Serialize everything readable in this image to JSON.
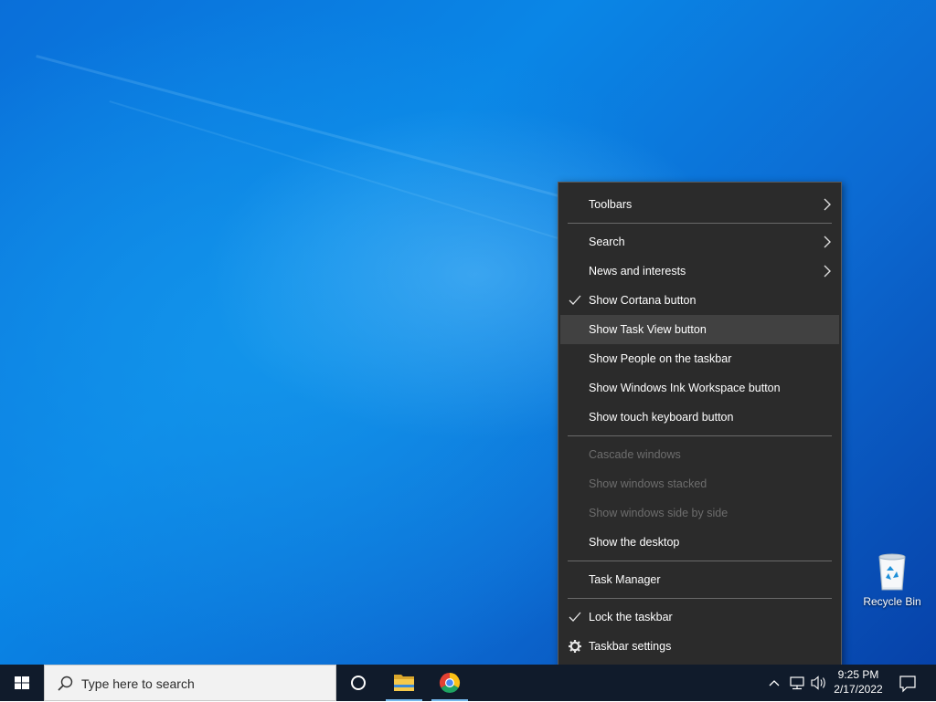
{
  "desktop": {
    "recycle_bin": {
      "label": "Recycle Bin",
      "icon": "recycle-bin-icon"
    }
  },
  "context_menu": {
    "items": [
      {
        "label": "Toolbars",
        "submenu": true,
        "checked": false,
        "disabled": false
      },
      {
        "label": "Search",
        "submenu": true,
        "checked": false,
        "disabled": false
      },
      {
        "label": "News and interests",
        "submenu": true,
        "checked": false,
        "disabled": false
      },
      {
        "label": "Show Cortana button",
        "submenu": false,
        "checked": true,
        "disabled": false
      },
      {
        "label": "Show Task View button",
        "submenu": false,
        "checked": false,
        "disabled": false,
        "highlighted": true
      },
      {
        "label": "Show People on the taskbar",
        "submenu": false,
        "checked": false,
        "disabled": false
      },
      {
        "label": "Show Windows Ink Workspace button",
        "submenu": false,
        "checked": false,
        "disabled": false
      },
      {
        "label": "Show touch keyboard button",
        "submenu": false,
        "checked": false,
        "disabled": false
      },
      {
        "label": "Cascade windows",
        "submenu": false,
        "checked": false,
        "disabled": true
      },
      {
        "label": "Show windows stacked",
        "submenu": false,
        "checked": false,
        "disabled": true
      },
      {
        "label": "Show windows side by side",
        "submenu": false,
        "checked": false,
        "disabled": true
      },
      {
        "label": "Show the desktop",
        "submenu": false,
        "checked": false,
        "disabled": false
      },
      {
        "label": "Task Manager",
        "submenu": false,
        "checked": false,
        "disabled": false
      },
      {
        "label": "Lock the taskbar",
        "submenu": false,
        "checked": true,
        "disabled": false
      },
      {
        "label": "Taskbar settings",
        "submenu": false,
        "checked": false,
        "disabled": false,
        "icon": "gear-icon"
      }
    ]
  },
  "taskbar": {
    "search_placeholder": "Type here to search",
    "apps": [
      "cortana-icon",
      "file-explorer-icon",
      "chrome-icon"
    ],
    "clock": {
      "time": "9:25 PM",
      "date": "2/17/2022"
    }
  },
  "colors": {
    "menu_bg": "#2b2b2b",
    "menu_hover": "#414141",
    "menu_disabled_text": "#6d6d6d",
    "taskbar_bg": "#101b2b",
    "desktop_blue": "#0a86e6",
    "active_indicator": "#76b9ed"
  }
}
